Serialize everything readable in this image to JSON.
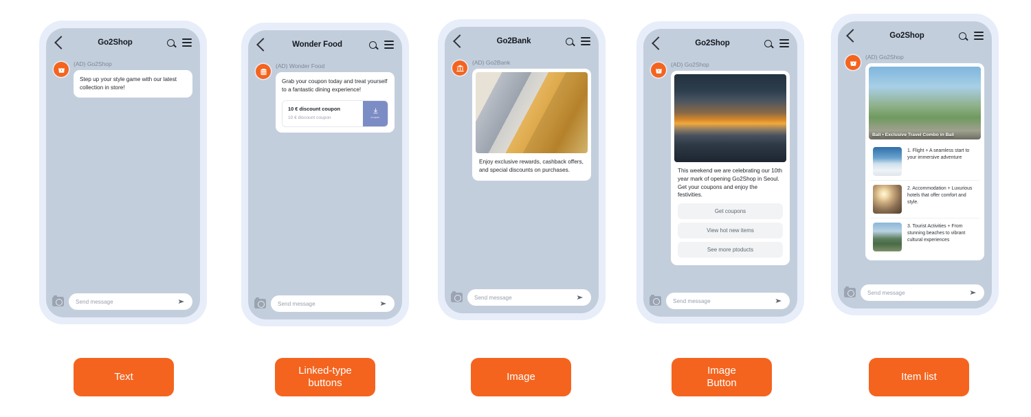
{
  "common": {
    "composer_placeholder": "Send message",
    "ad_prefix": "(AD)",
    "brand_orange": "#f4641e",
    "phone_frame_color": "#e7edf9",
    "screen_color": "#c3cedd",
    "icons": {
      "back": "chevron-left-icon",
      "search": "search-icon",
      "menu": "hamburger-menu-icon",
      "camera": "camera-icon",
      "send": "send-arrow-icon"
    }
  },
  "phones": [
    {
      "id": "text",
      "title": "Go2Shop",
      "avatar_icon": "shopping-bag-icon",
      "sender": "(AD) Go2Shop",
      "message": "Step up your style game with our latest collection in store!",
      "label": "Text"
    },
    {
      "id": "linked-type-buttons",
      "title": "Wonder Food",
      "avatar_icon": "burger-icon",
      "sender": "(AD) Wonder Food",
      "message": "Grab your coupon today and treat yourself to a fantastic dining experience!",
      "coupon": {
        "title": "10 € discount coupon",
        "subtitle": "10 € discount coupon",
        "button_label": "coupon",
        "button_icon": "download-icon",
        "button_color": "#7c8cc4"
      },
      "label": "Linked-type\nbuttons"
    },
    {
      "id": "image",
      "title": "Go2Bank",
      "avatar_icon": "bank-icon",
      "sender": "(AD) Go2Bank",
      "image_alt": "credit-cards-photo",
      "caption": "Enjoy exclusive rewards, cashback offers, and special discounts on purchases.",
      "label": "Image"
    },
    {
      "id": "image-button",
      "title": "Go2Shop",
      "avatar_icon": "shopping-bag-icon",
      "sender": "(AD) Go2Shop",
      "image_alt": "seoul-sunset-bridge-photo",
      "caption": "This weekend we are celebrating our 10th year mark of opening Go2Shop in Seoul. Get your coupons and enjoy the festivities.",
      "buttons": [
        "Get coupons",
        "View hot new items",
        "See more ptoducts"
      ],
      "label": "Image\nButton"
    },
    {
      "id": "item-list",
      "title": "Go2Shop",
      "avatar_icon": "shopping-bag-icon",
      "sender": "(AD) Go2Shop",
      "hero_alt": "bali-temple-gate-photo",
      "hero_caption": "Bali • Exclusive Travel Combo in Bali",
      "items": [
        {
          "thumb_alt": "airplane-wing-photo",
          "text": "1. Flight +  A seamless start to your immersive adventure"
        },
        {
          "thumb_alt": "hotel-room-photo",
          "text": "2. Accommodation + Luxurious hotels that offer comfort and style."
        },
        {
          "thumb_alt": "tourist-pagoda-photo",
          "text": "3. Tourist Activities + From stunning beaches to vibrant cultural experiences"
        }
      ],
      "label": "Item list"
    }
  ]
}
